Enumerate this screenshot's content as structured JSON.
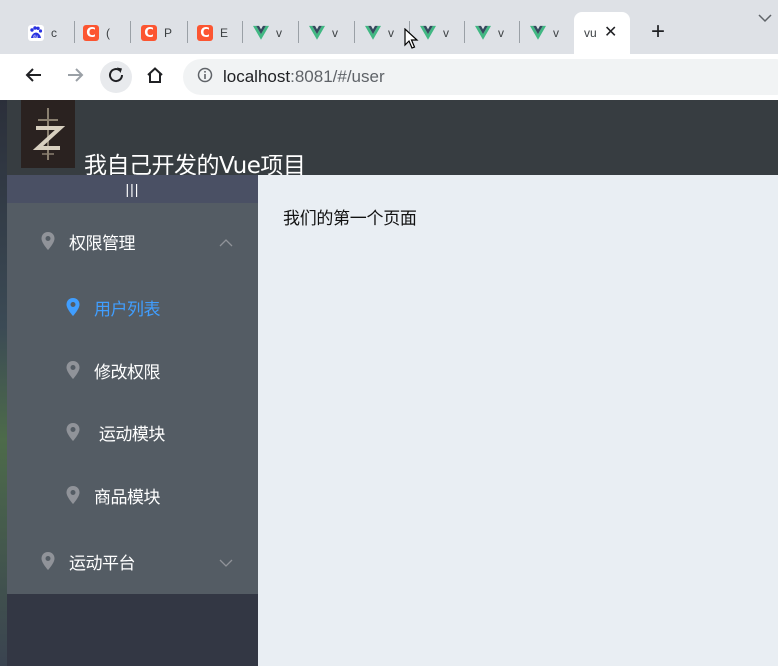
{
  "browser": {
    "tabs": [
      {
        "title": "c",
        "favicon": "baidu-icon"
      },
      {
        "title": "(",
        "favicon": "csdn-icon"
      },
      {
        "title": "P",
        "favicon": "csdn-icon"
      },
      {
        "title": "E",
        "favicon": "csdn-icon"
      },
      {
        "title": "v",
        "favicon": "vue-icon"
      },
      {
        "title": "v",
        "favicon": "vue-icon"
      },
      {
        "title": "v",
        "favicon": "vue-icon"
      },
      {
        "title": "v",
        "favicon": "vue-icon"
      },
      {
        "title": "v",
        "favicon": "vue-icon"
      },
      {
        "title": "v",
        "favicon": "vue-icon"
      }
    ],
    "active_tab": {
      "title": "vu",
      "close": "✕"
    },
    "new_tab": "+",
    "tab_menu": "⌄",
    "url_host": "localhost",
    "url_rest": ":8081/#/user",
    "colors": {
      "csdn": "#fc5531",
      "vue_green": "#41b883",
      "vue_dark": "#35495e"
    }
  },
  "app": {
    "title": "我自己开发的Vue项目",
    "collapse_label": "|||",
    "menu": [
      {
        "label": "权限管理",
        "type": "group",
        "expanded": true
      },
      {
        "label": "用户列表",
        "type": "item",
        "active": true
      },
      {
        "label": "修改权限",
        "type": "item"
      },
      {
        "label": " 运动模块",
        "type": "item"
      },
      {
        "label": "商品模块",
        "type": "item"
      },
      {
        "label": "运动平台",
        "type": "group",
        "expanded": false
      }
    ],
    "content_text": "我们的第一个页面",
    "colors": {
      "header": "#373d41",
      "sidebar": "#333744",
      "menu": "#545c64",
      "active": "#409eff",
      "content": "#e9eef3"
    }
  }
}
